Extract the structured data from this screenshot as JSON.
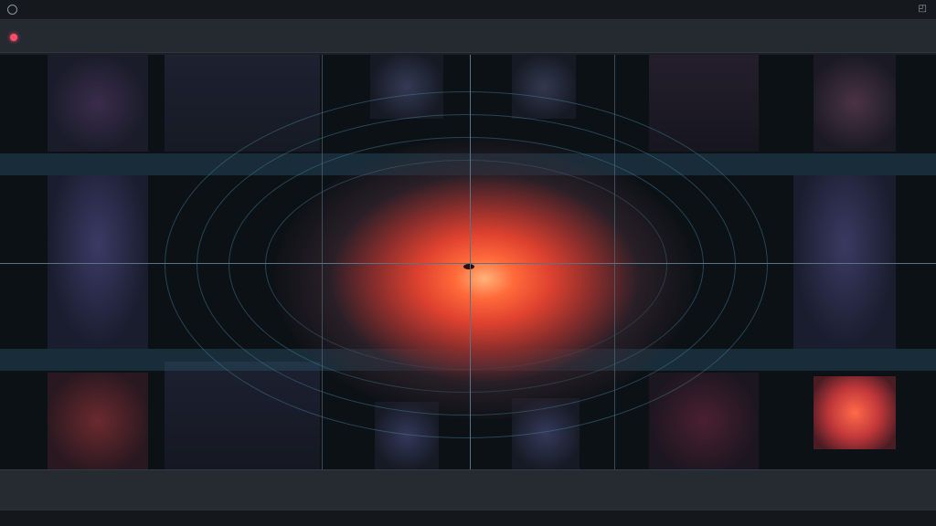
{
  "titlebar": {
    "app_title": "",
    "window_title": "",
    "control_glyph": "◰"
  },
  "toolbar": {
    "label": ""
  },
  "viewport": {
    "corner_label": ""
  },
  "statusbar": {
    "left": "",
    "center": "",
    "right": ""
  },
  "colors": {
    "accent_record": "#ff4d6a",
    "glow_core": "#ff6a3a",
    "rings": "#4682a0",
    "background": "#0c1116"
  },
  "icons": {
    "app": "circle-app-icon",
    "record": "record-dot-icon",
    "window": "window-restore-icon"
  }
}
